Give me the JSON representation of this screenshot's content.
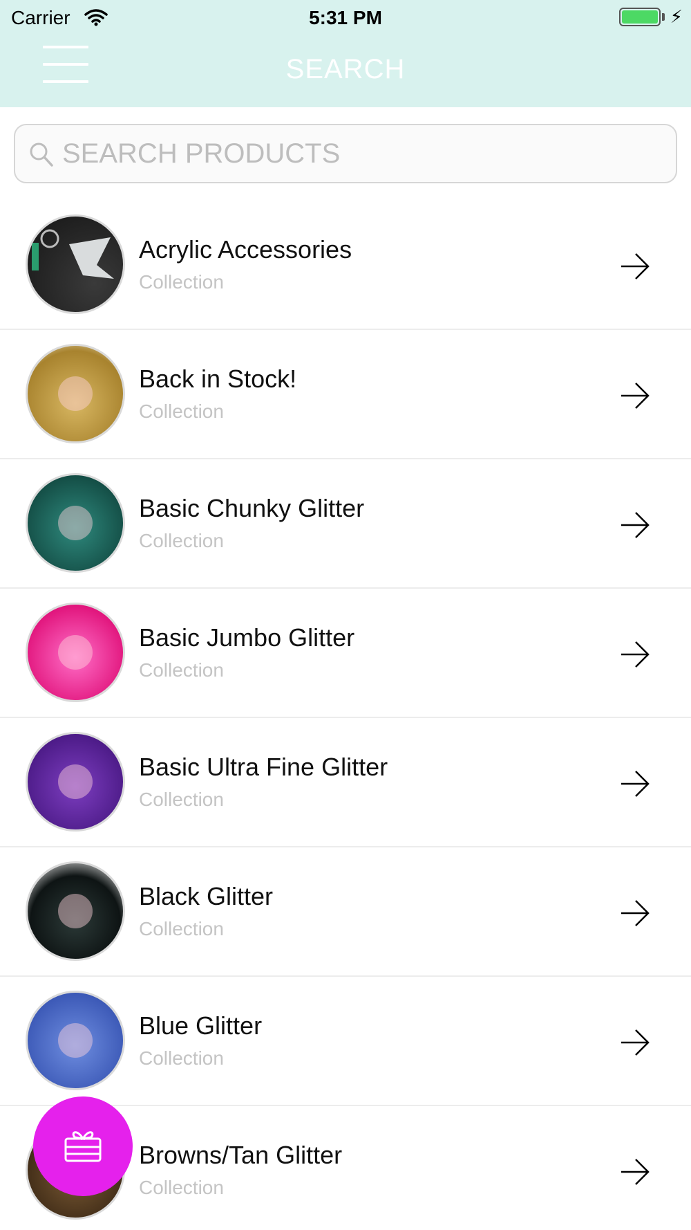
{
  "status_bar": {
    "carrier": "Carrier",
    "time": "5:31 PM"
  },
  "header": {
    "title": "SEARCH",
    "menu_icon": "hamburger-menu-icon",
    "background": "#d8f2ee"
  },
  "search": {
    "placeholder": "SEARCH PRODUCTS",
    "value": ""
  },
  "items": [
    {
      "title": "Acrylic Accessories",
      "subtitle": "Collection"
    },
    {
      "title": "Back in Stock!",
      "subtitle": "Collection"
    },
    {
      "title": "Basic Chunky Glitter",
      "subtitle": "Collection"
    },
    {
      "title": "Basic Jumbo Glitter",
      "subtitle": "Collection"
    },
    {
      "title": "Basic Ultra Fine Glitter",
      "subtitle": "Collection"
    },
    {
      "title": "Black Glitter",
      "subtitle": "Collection"
    },
    {
      "title": "Blue Glitter",
      "subtitle": "Collection"
    },
    {
      "title": "Browns/Tan Glitter",
      "subtitle": "Collection"
    }
  ],
  "fab": {
    "icon": "gift-icon",
    "color": "#e521ec"
  }
}
